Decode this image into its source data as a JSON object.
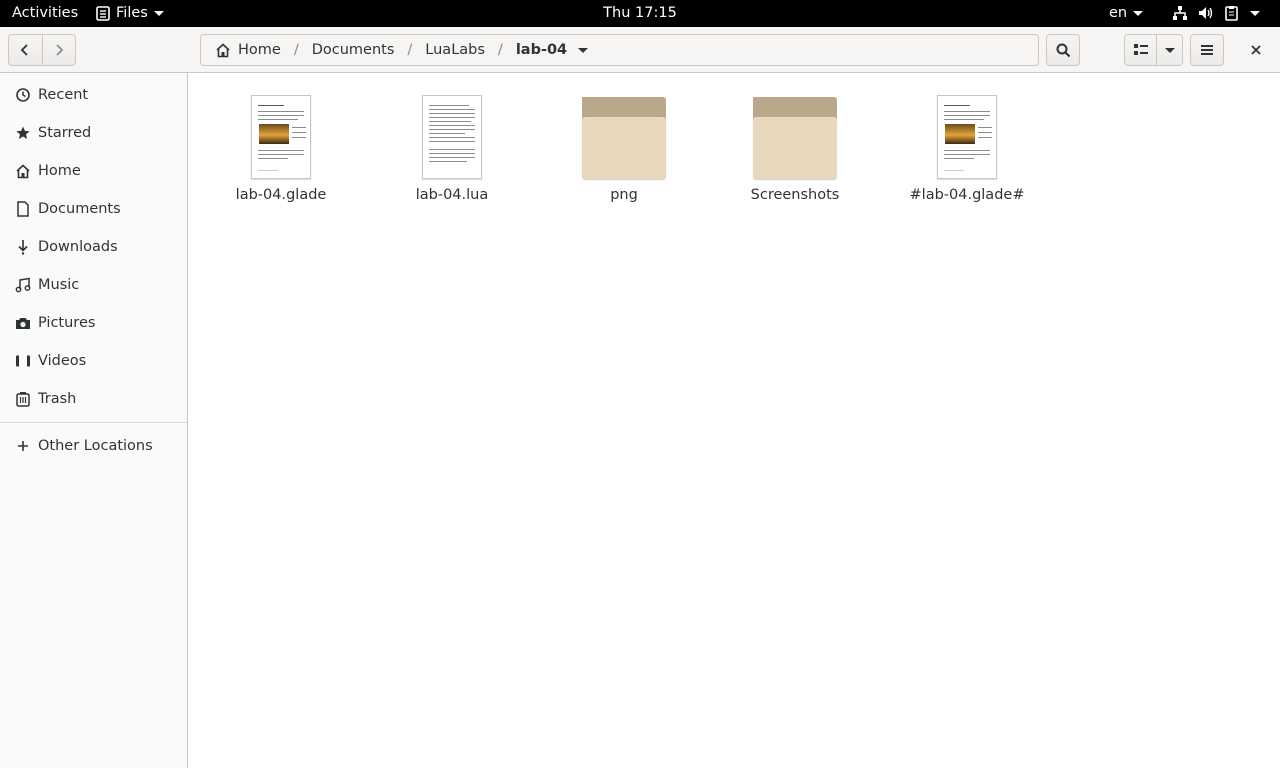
{
  "top_panel": {
    "activities": "Activities",
    "app_menu": "Files",
    "clock": "Thu 17:15",
    "language": "en"
  },
  "header": {
    "breadcrumbs": [
      {
        "label": "Home",
        "icon": "home-icon"
      },
      {
        "label": "Documents"
      },
      {
        "label": "LuaLabs"
      },
      {
        "label": "lab-04",
        "current": true
      }
    ]
  },
  "sidebar": {
    "items": [
      {
        "label": "Recent",
        "icon": "clock-icon"
      },
      {
        "label": "Starred",
        "icon": "star-icon"
      },
      {
        "label": "Home",
        "icon": "home-icon"
      },
      {
        "label": "Documents",
        "icon": "document-icon"
      },
      {
        "label": "Downloads",
        "icon": "download-icon"
      },
      {
        "label": "Music",
        "icon": "music-icon"
      },
      {
        "label": "Pictures",
        "icon": "camera-icon"
      },
      {
        "label": "Videos",
        "icon": "video-icon"
      },
      {
        "label": "Trash",
        "icon": "trash-icon"
      }
    ],
    "other_locations": "Other Locations"
  },
  "files": [
    {
      "name": "lab-04.glade",
      "type": "document-with-image"
    },
    {
      "name": "lab-04.lua",
      "type": "document"
    },
    {
      "name": "png",
      "type": "folder"
    },
    {
      "name": "Screenshots",
      "type": "folder"
    },
    {
      "name": "#lab-04.glade#",
      "type": "document-with-image"
    }
  ],
  "colors": {
    "panel_bg": "#000000",
    "headerbar_bg": "#f6f5f4",
    "sidebar_bg": "#fbfafa",
    "folder_front": "#e8d8bd",
    "folder_back": "#b9a88a"
  }
}
